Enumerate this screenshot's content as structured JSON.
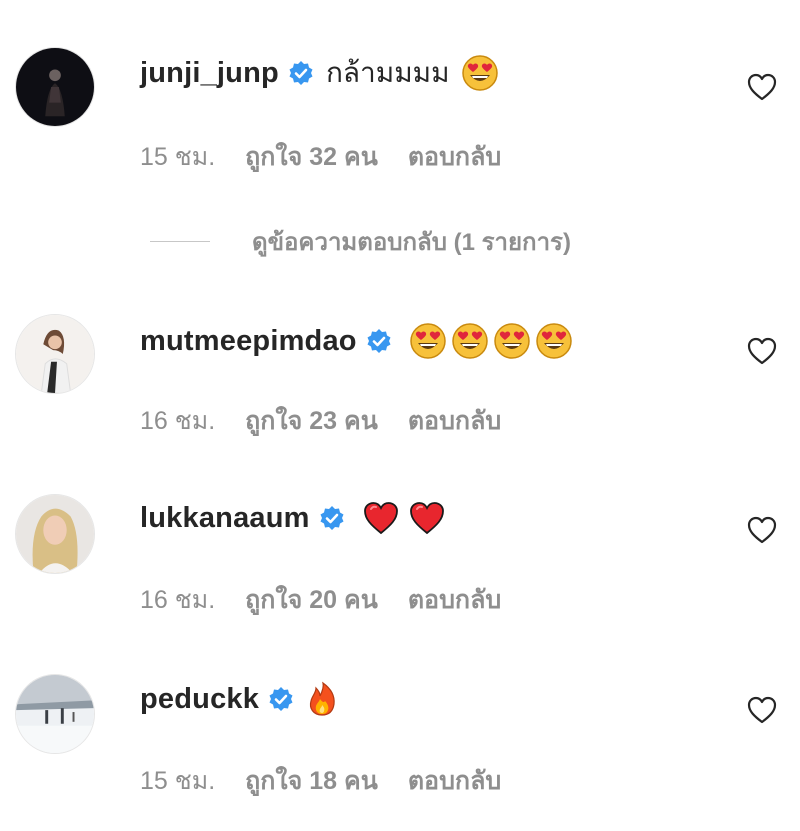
{
  "comments": [
    {
      "username": "junji_junp",
      "text": "กล้ามมมม",
      "emojis": [
        "heart-eyes"
      ],
      "time": "15 ชม.",
      "likes": "ถูกใจ 32 คน",
      "reply": "ตอบกลับ"
    },
    {
      "username": "mutmeepimdao",
      "text": "",
      "emojis": [
        "heart-eyes",
        "heart-eyes",
        "heart-eyes",
        "heart-eyes"
      ],
      "time": "16 ชม.",
      "likes": "ถูกใจ 23 คน",
      "reply": "ตอบกลับ"
    },
    {
      "username": "lukkanaaum",
      "text": "",
      "emojis": [
        "red-heart",
        "red-heart"
      ],
      "time": "16 ชม.",
      "likes": "ถูกใจ 20 คน",
      "reply": "ตอบกลับ"
    },
    {
      "username": "peduckk",
      "text": "",
      "emojis": [
        "fire"
      ],
      "time": "15 ชม.",
      "likes": "ถูกใจ 18 คน",
      "reply": "ตอบกลับ"
    }
  ],
  "view_replies": "ดูข้อความตอบกลับ (1 รายการ)",
  "colors": {
    "verified": "#3897f0",
    "muted": "#8e8e8e",
    "text": "#262626"
  }
}
